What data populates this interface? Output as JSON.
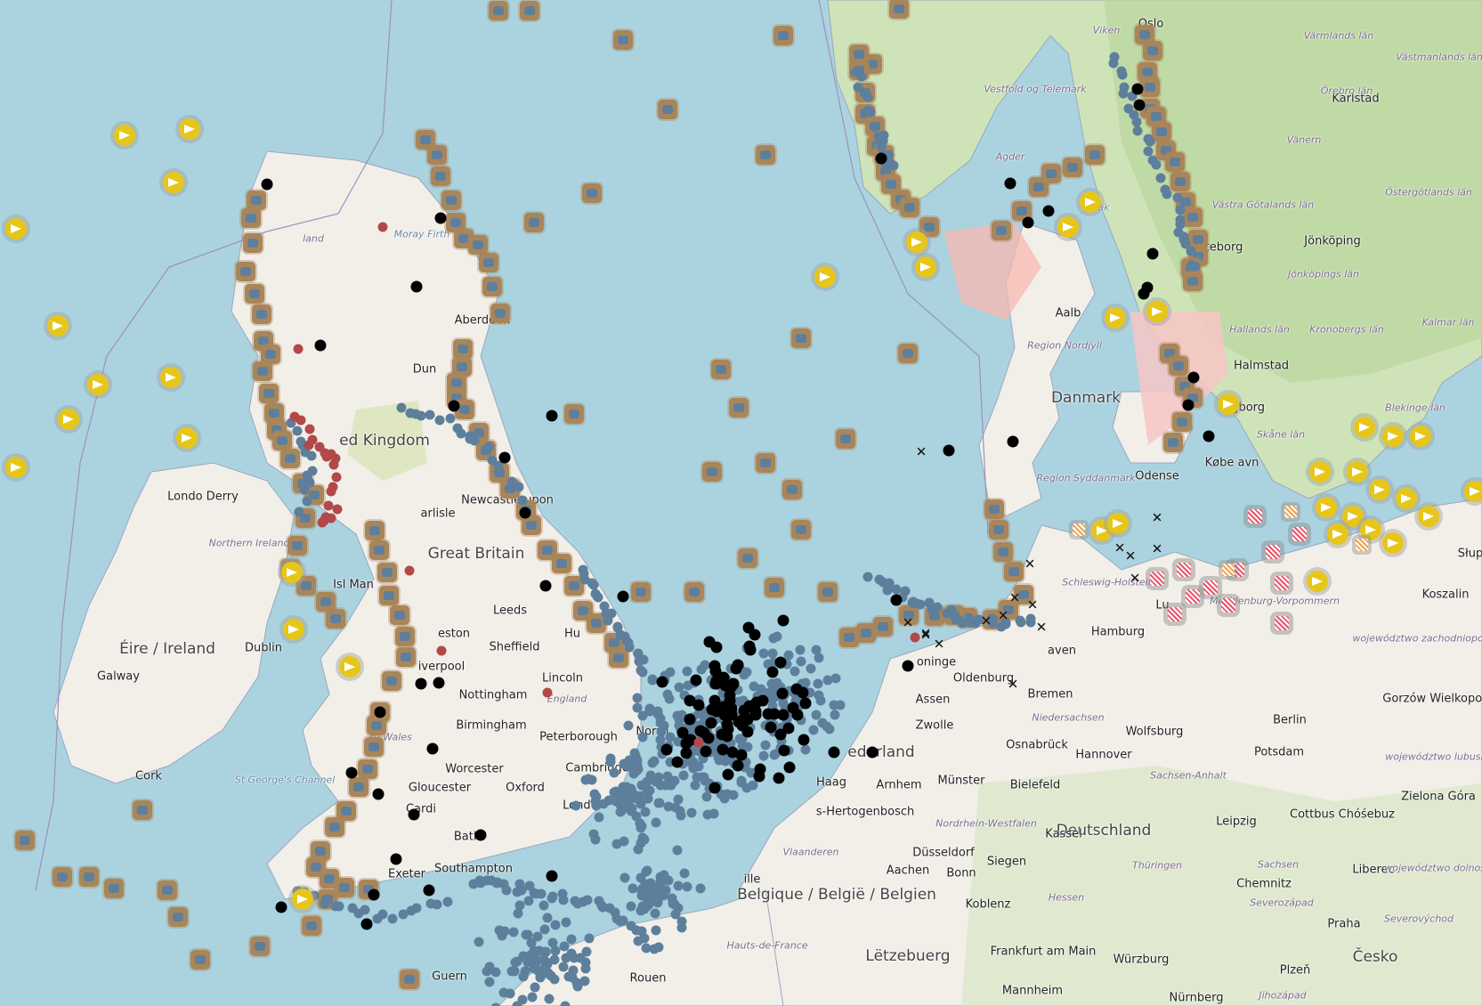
{
  "map": {
    "country_labels": [
      {
        "id": "denmark",
        "text": "Danmark"
      },
      {
        "id": "uk",
        "text": "ed Kingdom"
      },
      {
        "id": "great-britain",
        "text": "Great Britain"
      },
      {
        "id": "ireland",
        "text": "Éire / Ireland"
      },
      {
        "id": "germany",
        "text": "Deutschland"
      },
      {
        "id": "belgium",
        "text": "Belgique / België / Belgien"
      },
      {
        "id": "netherlands",
        "text": "ederland"
      },
      {
        "id": "luxembourg",
        "text": "Lëtzebuerg"
      },
      {
        "id": "czech",
        "text": "Česko"
      }
    ],
    "city_labels": [
      {
        "id": "oslo",
        "text": "Oslo"
      },
      {
        "id": "karlstad",
        "text": "Karlstad"
      },
      {
        "id": "jonkoping",
        "text": "Jönköping"
      },
      {
        "id": "goteborg",
        "text": "teborg"
      },
      {
        "id": "halmstad",
        "text": "Halmstad"
      },
      {
        "id": "helsingborg",
        "text": "ngborg"
      },
      {
        "id": "kobenhavn",
        "text": "Købe  avn"
      },
      {
        "id": "odense",
        "text": "Odense"
      },
      {
        "id": "aalborg",
        "text": "Aalb"
      },
      {
        "id": "hamburg",
        "text": "Hamburg"
      },
      {
        "id": "bremen",
        "text": "Bremen"
      },
      {
        "id": "hannover",
        "text": "Hannover"
      },
      {
        "id": "berlin",
        "text": "Berlin"
      },
      {
        "id": "potsdam",
        "text": "Potsdam"
      },
      {
        "id": "leipzig",
        "text": "Leipzig"
      },
      {
        "id": "koszalin",
        "text": "Koszalin"
      },
      {
        "id": "praha",
        "text": "Praha"
      },
      {
        "id": "dublin",
        "text": "Dublin"
      },
      {
        "id": "cork",
        "text": "Cork"
      },
      {
        "id": "galway",
        "text": "Galway"
      },
      {
        "id": "london",
        "text": "London"
      },
      {
        "id": "birmingham",
        "text": "Birmingham"
      },
      {
        "id": "leeds",
        "text": "Leeds"
      },
      {
        "id": "sheffield",
        "text": "Sheffield"
      },
      {
        "id": "liverpool",
        "text": "iverpool"
      },
      {
        "id": "nottingham",
        "text": "Nottingham"
      },
      {
        "id": "lincoln",
        "text": "Lincoln"
      },
      {
        "id": "aberdeen",
        "text": "Aberdeen"
      },
      {
        "id": "newcastle",
        "text": "Newcastle upon"
      },
      {
        "id": "carlisle",
        "text": "arlisle"
      },
      {
        "id": "cardiff",
        "text": "Cardi"
      },
      {
        "id": "bath",
        "text": "Bath"
      },
      {
        "id": "exeter",
        "text": "Exeter"
      },
      {
        "id": "southampton",
        "text": "Southampton"
      },
      {
        "id": "oxford",
        "text": "Oxford"
      },
      {
        "id": "cambridge",
        "text": "Cambridge"
      },
      {
        "id": "peterborough",
        "text": "Peterborough"
      },
      {
        "id": "gloucester",
        "text": "Gloucester"
      },
      {
        "id": "worcester",
        "text": "Worcester"
      },
      {
        "id": "norwich",
        "text": "Norwi"
      },
      {
        "id": "derry",
        "text": "Londo Derry"
      },
      {
        "id": "dun",
        "text": "Dun"
      },
      {
        "id": "preston",
        "text": "eston"
      },
      {
        "id": "hull",
        "text": "Hu"
      },
      {
        "id": "douglas",
        "text": "Isl  Man"
      },
      {
        "id": "haag",
        "text": "Haag"
      },
      {
        "id": "groningen",
        "text": "oninge"
      },
      {
        "id": "assen",
        "text": "Assen"
      },
      {
        "id": "zwolle",
        "text": "Zwolle"
      },
      {
        "id": "arnhem",
        "text": "Arnhem"
      },
      {
        "id": "hertogenbosch",
        "text": "s-Hertogenbosch"
      },
      {
        "id": "munster",
        "text": "Münster"
      },
      {
        "id": "osnabruck",
        "text": "Osnabrück"
      },
      {
        "id": "bielefeld",
        "text": "Bielefeld"
      },
      {
        "id": "oldenburg",
        "text": "Oldenburg"
      },
      {
        "id": "wolfsburg",
        "text": "Wolfsburg"
      },
      {
        "id": "kassel",
        "text": "Kassel"
      },
      {
        "id": "dusseldorf",
        "text": "Düsseldorf"
      },
      {
        "id": "aachen",
        "text": "Aachen"
      },
      {
        "id": "bonn",
        "text": "Bonn"
      },
      {
        "id": "siegen",
        "text": "Siegen"
      },
      {
        "id": "koblenz",
        "text": "Koblenz"
      },
      {
        "id": "frankfurt",
        "text": "Frankfurt am Main"
      },
      {
        "id": "wurzburg",
        "text": "Würzburg"
      },
      {
        "id": "mannheim",
        "text": "Mannheim"
      },
      {
        "id": "nurnberg",
        "text": "Nürnberg"
      },
      {
        "id": "chemnitz",
        "text": "Chemnitz"
      },
      {
        "id": "liberec",
        "text": "Liberec"
      },
      {
        "id": "plzen",
        "text": "Plzeň"
      },
      {
        "id": "zielona",
        "text": "Zielona Góra"
      },
      {
        "id": "cottbus",
        "text": "Cottbus Chóśebuz"
      },
      {
        "id": "gorzow",
        "text": "Gorzów Wielkopolski"
      },
      {
        "id": "lille",
        "text": "ille"
      },
      {
        "id": "rouen",
        "text": "Rouen"
      },
      {
        "id": "bremerhaven",
        "text": "aven"
      },
      {
        "id": "lubeck",
        "text": "Lu"
      },
      {
        "id": "slup",
        "text": "Słup"
      },
      {
        "id": "guernsey",
        "text": "Guern"
      },
      {
        "id": "bou",
        "text": "Bo"
      }
    ],
    "region_labels": [
      {
        "id": "varmland",
        "text": "Värmlands län"
      },
      {
        "id": "vastmanland",
        "text": "Västmanlands län"
      },
      {
        "id": "orebro",
        "text": "Örebro län"
      },
      {
        "id": "vestfold",
        "text": "Vestfold og Telemark"
      },
      {
        "id": "viken",
        "text": "Viken"
      },
      {
        "id": "agder",
        "text": "Agder"
      },
      {
        "id": "vanern",
        "text": "Vänern"
      },
      {
        "id": "vastra-gotaland",
        "text": "Västra Götalands län"
      },
      {
        "id": "ostergotland",
        "text": "Östergötlands län"
      },
      {
        "id": "jonkopings-lan",
        "text": "Jönköpings län"
      },
      {
        "id": "halland",
        "text": "Hallands län"
      },
      {
        "id": "kronoberg",
        "text": "Kronobergs län"
      },
      {
        "id": "kalmar",
        "text": "Kalmar län"
      },
      {
        "id": "blekinge",
        "text": "Blekinge län"
      },
      {
        "id": "skane",
        "text": "Skåne län"
      },
      {
        "id": "nordjylland",
        "text": "Region Nordjyll"
      },
      {
        "id": "syddanmark",
        "text": "Region Syddanmark"
      },
      {
        "id": "schleswig",
        "text": "Schleswig-Holstein"
      },
      {
        "id": "mecklenburg",
        "text": "Mecklenburg-Vorpommern"
      },
      {
        "id": "zachodnio",
        "text": "województwo zachodniopomorskie"
      },
      {
        "id": "lubuskie",
        "text": "województwo lubuskie"
      },
      {
        "id": "dolnoslaskie",
        "text": "województwo dolnośląskie"
      },
      {
        "id": "niedersachsen",
        "text": "Niedersachsen"
      },
      {
        "id": "nrw",
        "text": "Nordrhein-Westfalen"
      },
      {
        "id": "sachsen-anhalt",
        "text": "Sachsen-Anhalt"
      },
      {
        "id": "sachsen",
        "text": "Sachsen"
      },
      {
        "id": "thuringen",
        "text": "Thüringen"
      },
      {
        "id": "hessen",
        "text": "Hessen"
      },
      {
        "id": "northern-ireland",
        "text": "Northern Ireland"
      },
      {
        "id": "england",
        "text": "England"
      },
      {
        "id": "scotland",
        "text": "land"
      },
      {
        "id": "wales",
        "text": "ru Wales"
      },
      {
        "id": "vlaanderen",
        "text": "Vlaanderen"
      },
      {
        "id": "hauts-de-france",
        "text": "Hauts-de-France"
      },
      {
        "id": "severozapad",
        "text": "Severozápad"
      },
      {
        "id": "severovychod",
        "text": "Severovýchod"
      },
      {
        "id": "jihozapad",
        "text": "Jihozápad"
      }
    ],
    "sea_labels": [
      {
        "id": "moray",
        "text": "Moray Firth"
      },
      {
        "id": "st-georges",
        "text": "St George's Channel"
      },
      {
        "id": "skagerrak",
        "text": "ak"
      }
    ],
    "marker_icons": [
      "wreck-icon",
      "yellow-flag-icon",
      "black-dot-icon",
      "blue-dot-icon",
      "red-dot-icon",
      "x-mark-icon",
      "hatched-area-icon"
    ],
    "colors": {
      "sea": "#aad3df",
      "land": "#f2efe9",
      "forest": "#c8ddb0",
      "wreck": "#a9855a",
      "wreck_inner": "#5d7f9c",
      "yellow": "#e6c619",
      "black": "#000000",
      "blue": "#5d7f9c",
      "red": "#b34848",
      "restricted": "#f7c6c6",
      "hatch": "#e8566a"
    }
  }
}
